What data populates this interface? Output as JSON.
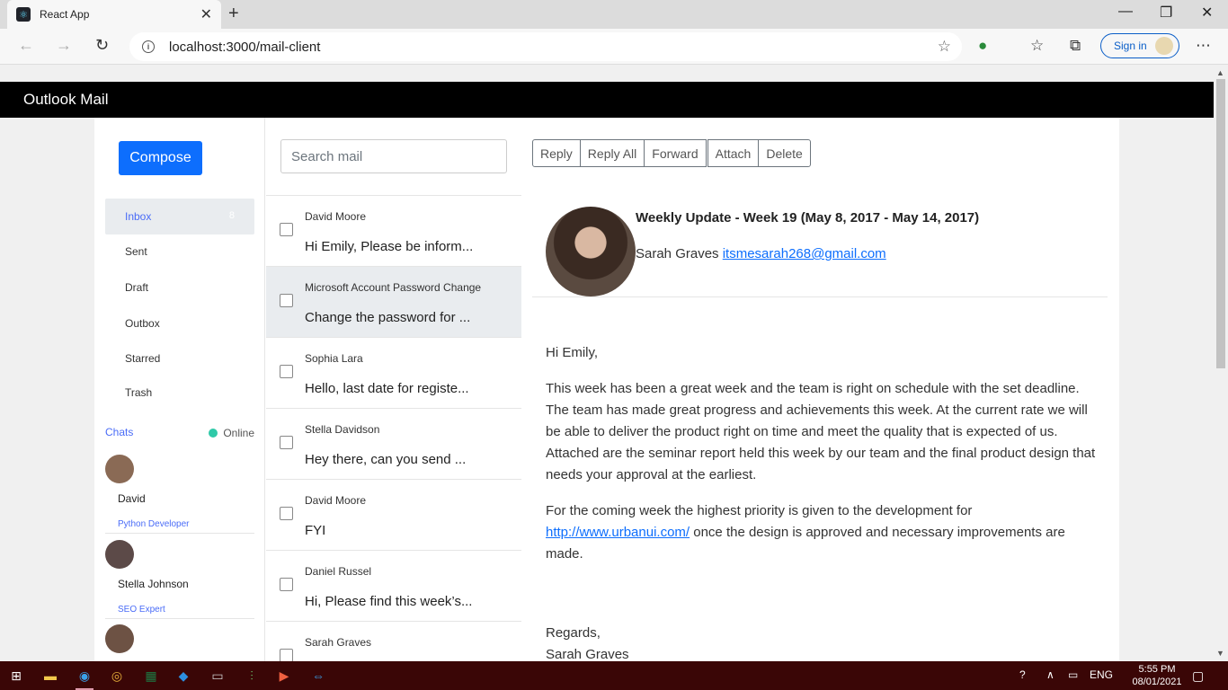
{
  "browser": {
    "tab_title": "React App",
    "url": "localhost:3000/mail-client",
    "signin_label": "Sign in"
  },
  "app": {
    "title": "Outlook Mail"
  },
  "sidebar": {
    "compose_label": "Compose",
    "folders": [
      {
        "label": "Inbox",
        "count": "8"
      },
      {
        "label": "Sent"
      },
      {
        "label": "Draft"
      },
      {
        "label": "Outbox"
      },
      {
        "label": "Starred"
      },
      {
        "label": "Trash"
      }
    ],
    "chats_label": "Chats",
    "online_label": "Online",
    "chats": [
      {
        "name": "David",
        "role": "Python Developer"
      },
      {
        "name": "Stella Johnson",
        "role": "SEO Expert"
      }
    ]
  },
  "maillist": {
    "search_placeholder": "Search mail",
    "mails": [
      {
        "from": "David Moore",
        "preview": "Hi Emily, Please be inform..."
      },
      {
        "from": "Microsoft Account Password Change",
        "preview": "Change the password for ..."
      },
      {
        "from": "Sophia Lara",
        "preview": "Hello, last date for registe..."
      },
      {
        "from": "Stella Davidson",
        "preview": "Hey there, can you send ..."
      },
      {
        "from": "David Moore",
        "preview": "FYI"
      },
      {
        "from": "Daniel Russel",
        "preview": "Hi, Please find this week’s..."
      },
      {
        "from": "Sarah Graves",
        "preview": ""
      }
    ]
  },
  "reader": {
    "actions": [
      "Reply",
      "Reply All",
      "Forward",
      "Attach",
      "Delete"
    ],
    "subject": "Weekly Update - Week 19 (May 8, 2017 - May 14, 2017)",
    "sender_name": "Sarah Graves",
    "sender_email": "itsmesarah268@gmail.com",
    "greeting": "Hi Emily,",
    "para1": "This week has been a great week and the team is right on schedule with the set deadline. The team has made great progress and achievements this week. At the current rate we will be able to deliver the product right on time and meet the quality that is expected of us. Attached are the seminar report held this week by our team and the final product design that needs your approval at the earliest.",
    "para2_before": "For the coming week the highest priority is given to the development for",
    "para2_link": "http://www.urbanui.com/",
    "para2_after": " once the design is approved and necessary improvements are made.",
    "regards": "Regards,",
    "signature": "Sarah Graves"
  },
  "taskbar": {
    "lang": "ENG",
    "time": "5:55 PM",
    "date": "08/01/2021"
  },
  "colors": {
    "accent": "#0d6efd",
    "appbar": "#000000",
    "taskbar": "#3a0606",
    "online": "#2fc9a8"
  }
}
